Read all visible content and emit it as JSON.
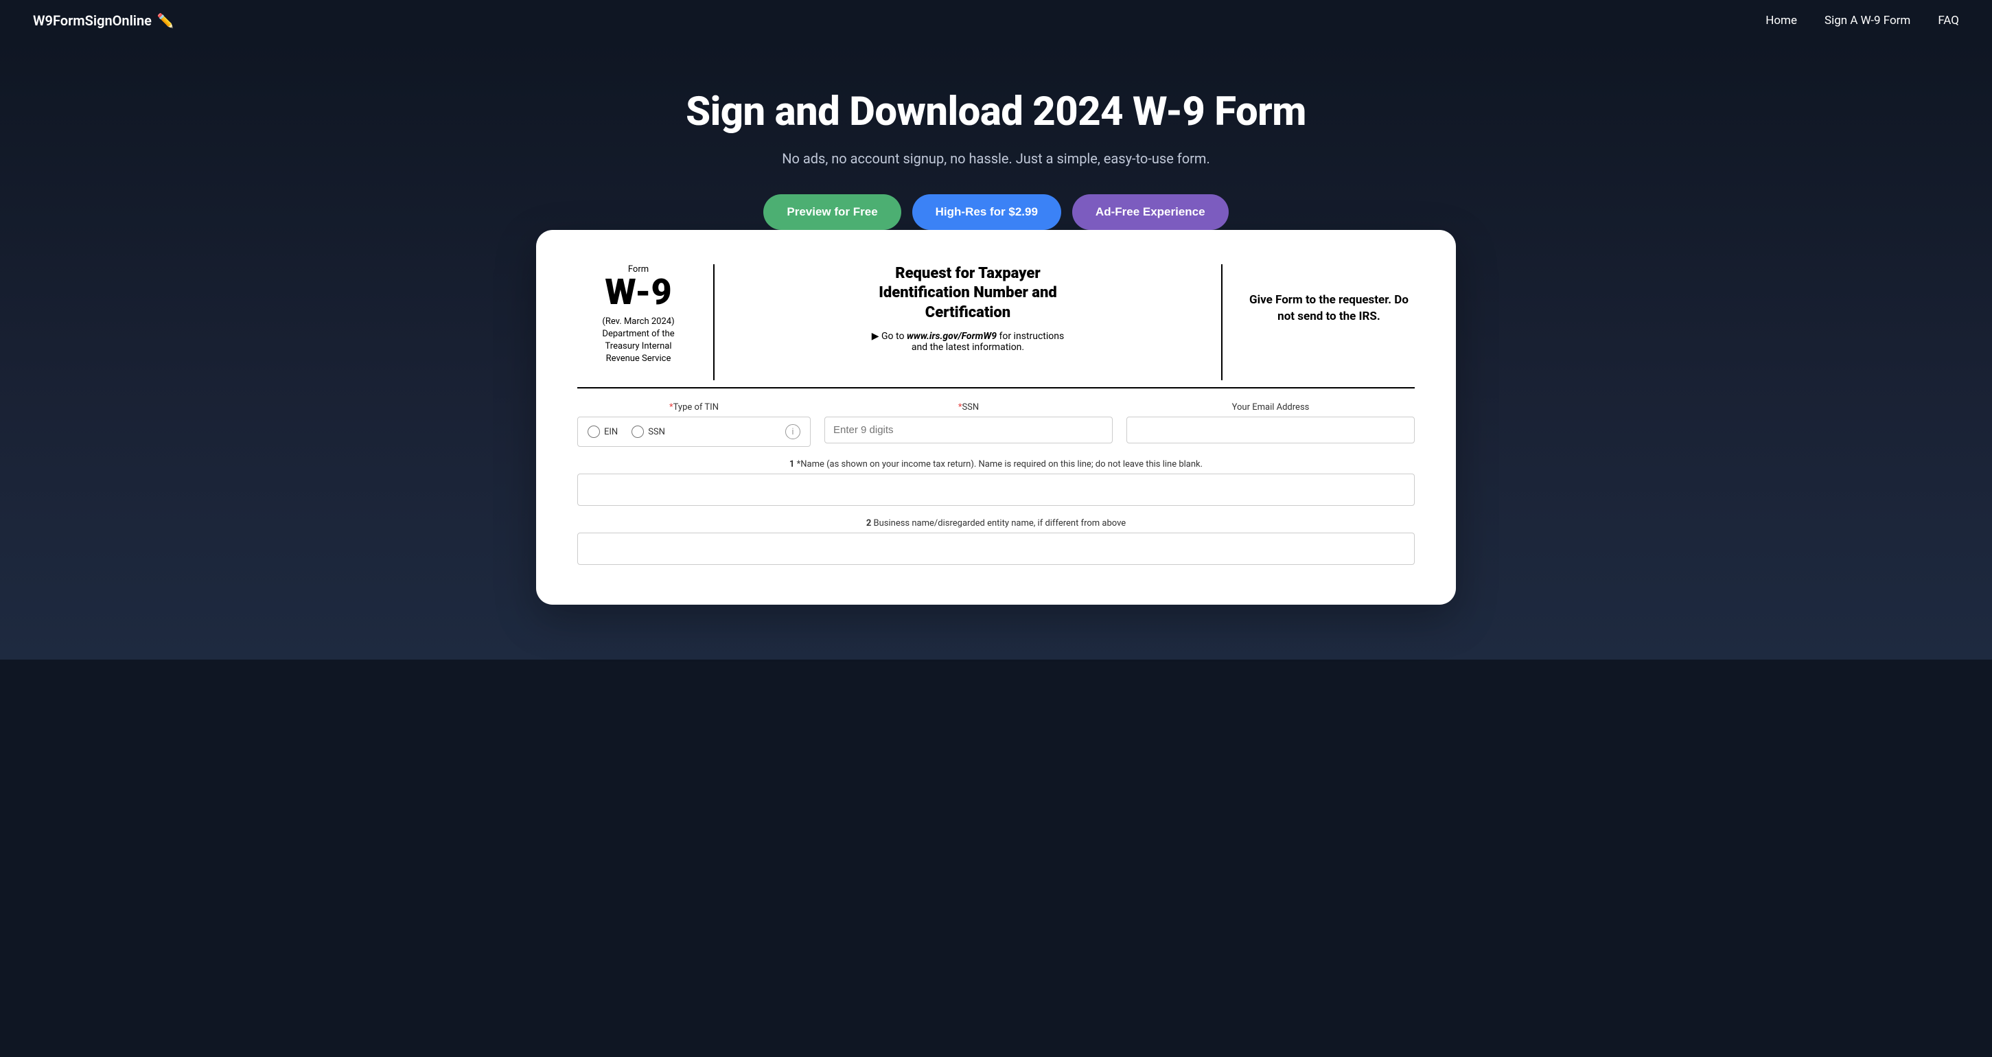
{
  "nav": {
    "logo": "W9FormSignOnline ✏️",
    "logo_text": "W9FormSignOnline",
    "logo_icon": "✏️",
    "links": [
      {
        "label": "Home",
        "href": "#"
      },
      {
        "label": "Sign A W-9 Form",
        "href": "#"
      },
      {
        "label": "FAQ",
        "href": "#"
      }
    ]
  },
  "hero": {
    "title": "Sign and Download 2024 W-9 Form",
    "subtitle": "No ads, no account signup, no hassle. Just a simple, easy-to-use form.",
    "buttons": {
      "preview": "Preview for Free",
      "highres": "High-Res for $2.99",
      "adfree": "Ad-Free Experience"
    }
  },
  "w9form": {
    "header": {
      "form_label": "Form",
      "form_number": "W-9",
      "rev_info": "(Rev. March 2024)\nDepartment of the\nTreasury Internal\nRevenue Service",
      "center_title": "Request for Taxpayer\nIdentification Number and\nCertification",
      "center_instruction": "▶ Go to www.irs.gov/FormW9 for instructions\nand the latest information.",
      "right_text": "Give Form to the requester. Do\nnot send to the IRS."
    },
    "fields": {
      "tin_label": "*Type of TIN",
      "tin_options": [
        "EIN",
        "SSN"
      ],
      "ssn_label": "*SSN",
      "ssn_placeholder": "Enter 9 digits",
      "email_label": "Your Email Address",
      "name_label_number": "1",
      "name_label": "*Name (as shown on your income tax return). Name is required on this line; do not leave this line blank.",
      "business_label_number": "2",
      "business_label": "Business name/disregarded entity name, if different from above"
    }
  }
}
